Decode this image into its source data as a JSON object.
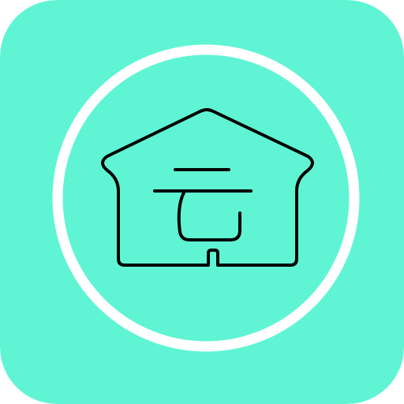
{
  "app_icon": {
    "name": "cloud-house-app",
    "icon": "house-cloud-icon",
    "glyph": "云",
    "colors": {
      "background": "#5FF5D4",
      "ring": "#FFFFFF",
      "stroke": "#000000"
    }
  }
}
